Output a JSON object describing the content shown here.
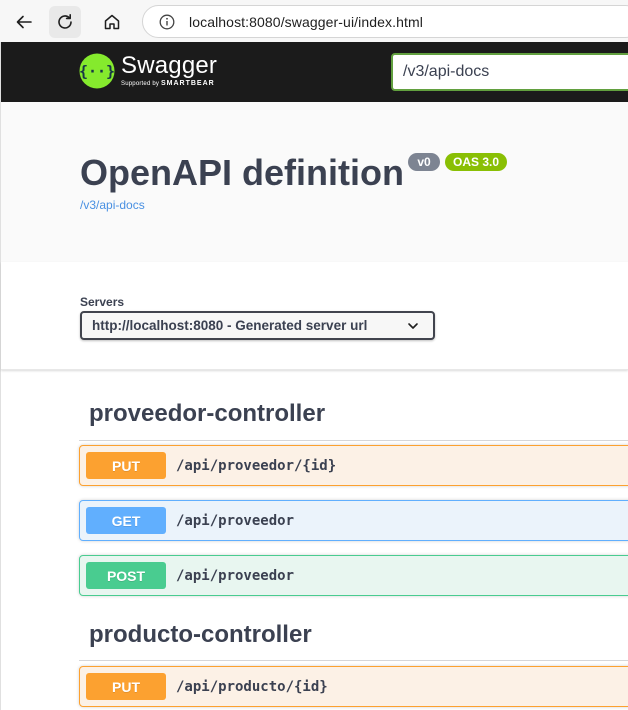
{
  "browser": {
    "url": "localhost:8080/swagger-ui/index.html"
  },
  "topbar": {
    "logo_text": "Swagger",
    "logo_sub_prefix": "Supported by",
    "logo_sub_brand": "SMARTBEAR",
    "spec_url_value": "/v3/api-docs"
  },
  "info": {
    "title": "OpenAPI definition",
    "version_badge": "v0",
    "oas_badge": "OAS 3.0",
    "docs_link": "/v3/api-docs"
  },
  "servers": {
    "label": "Servers",
    "selected": "http://localhost:8080 - Generated server url"
  },
  "tags": [
    {
      "name": "proveedor-controller",
      "operations": [
        {
          "method": "PUT",
          "path": "/api/proveedor/{id}"
        },
        {
          "method": "GET",
          "path": "/api/proveedor"
        },
        {
          "method": "POST",
          "path": "/api/proveedor"
        }
      ]
    },
    {
      "name": "producto-controller",
      "operations": [
        {
          "method": "PUT",
          "path": "/api/producto/{id}"
        }
      ]
    }
  ],
  "colors": {
    "topbar_bg": "#1b1b1b",
    "logo_green": "#85ea2d",
    "put": "#fca130",
    "get": "#61affe",
    "post": "#49cc90",
    "oas_badge": "#89bf04",
    "version_badge": "#7d8492",
    "link": "#4990e2"
  },
  "icons": [
    "back-arrow-icon",
    "reload-icon",
    "home-icon",
    "info-circle-icon",
    "swagger-logo-icon",
    "chevron-down-icon"
  ]
}
